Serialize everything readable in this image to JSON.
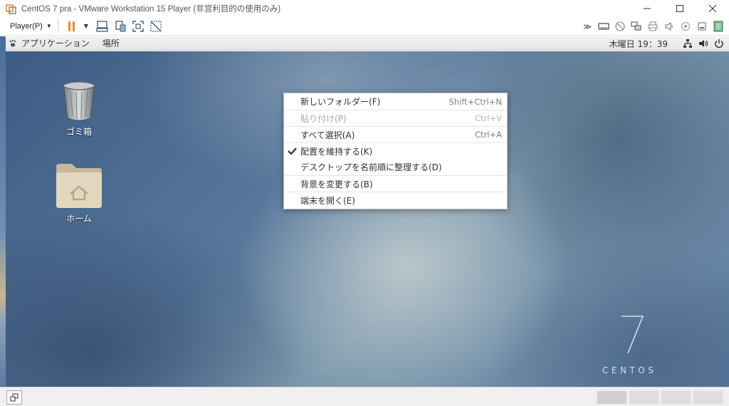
{
  "window": {
    "title": "CentOS 7 pra - VMware Workstation 15 Player (非営利目的の使用のみ)",
    "controls": [
      "minimize-icon",
      "maximize-icon",
      "close-icon"
    ]
  },
  "vmware_toolbar": {
    "player_label": "Player(P)",
    "left_icons": [
      "pause-icon",
      "dropdown-caret-icon",
      "send-ctrl-alt-del-icon",
      "removable-devices-icon",
      "fullscreen-icon",
      "unity-icon"
    ],
    "right_icons": [
      "more-icon",
      "hard-disk-icon",
      "cd-dvd-icon",
      "network-adapter-icon",
      "printer-icon",
      "sound-icon",
      "usb-icon",
      "hard-disk-2-icon",
      "message-log-icon"
    ]
  },
  "gnome_bar": {
    "applications_label": "アプリケーション",
    "places_label": "場所",
    "clock": "木曜日 19：39",
    "status_icons": [
      "network-wired-icon",
      "volume-icon",
      "power-icon"
    ]
  },
  "desktop": {
    "icons": [
      {
        "label": "ゴミ箱",
        "icon": "trash-icon"
      },
      {
        "label": "ホーム",
        "icon": "home-folder-icon"
      }
    ],
    "branding": {
      "number": "7",
      "word": "CENTOS"
    }
  },
  "context_menu": {
    "items": [
      {
        "label": "新しいフォルダー(F)",
        "accel": "Shift+Ctrl+N",
        "enabled": true,
        "checked": false
      },
      {
        "label": "貼り付け(P)",
        "accel": "Ctrl+V",
        "enabled": false,
        "checked": false
      },
      {
        "label": "すべて選択(A)",
        "accel": "Ctrl+A",
        "enabled": true,
        "checked": false
      },
      {
        "label": "配置を維持する(K)",
        "accel": "",
        "enabled": true,
        "checked": true
      },
      {
        "label": "デスクトップを名前順に整理する(D)",
        "accel": "",
        "enabled": true,
        "checked": false
      },
      {
        "label": "背景を変更する(B)",
        "accel": "",
        "enabled": true,
        "checked": false
      },
      {
        "label": "端末を開く(E)",
        "accel": "",
        "enabled": true,
        "checked": false
      }
    ]
  },
  "statusbar": {
    "restore_icon": "restore-window-icon"
  },
  "colors": {
    "accent_orange": "#f08a24",
    "menu_text": "#2e3436",
    "menu_disabled": "#a7aaab"
  }
}
